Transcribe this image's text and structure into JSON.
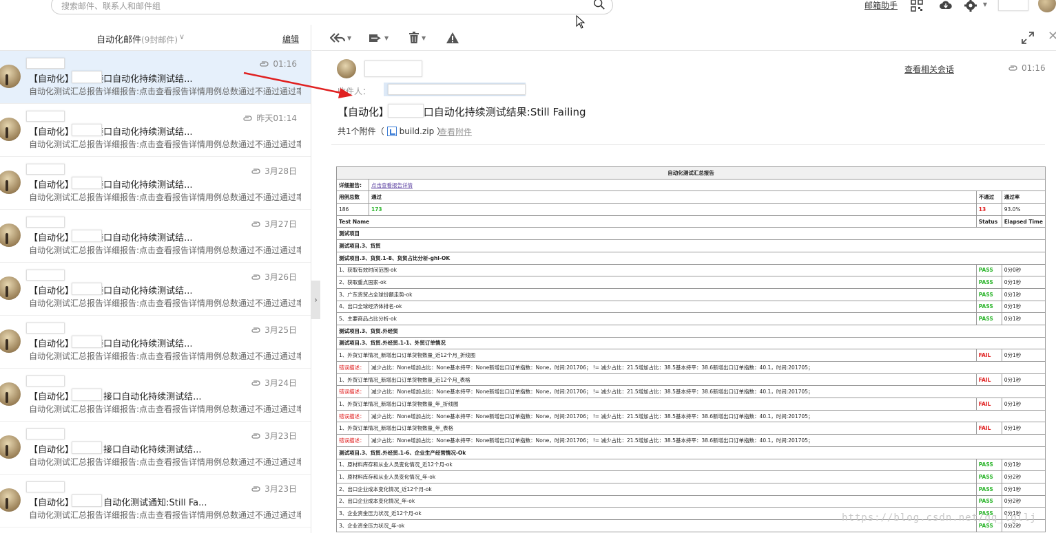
{
  "search": {
    "placeholder": "搜索邮件、联系人和邮件组"
  },
  "toplinks": {
    "helper": "邮箱助手"
  },
  "folder": {
    "title": "自动化邮件",
    "count": "(9封邮件)",
    "edit": "编辑"
  },
  "mails": [
    {
      "time": "01:16",
      "subject": "【自动化】         项目接口自动化持续测试结...",
      "preview": "自动化测试汇总报告详细报告:点击查看报告详情用例总数通过不通过通过率..."
    },
    {
      "time": "昨天01:14",
      "subject": "【自动化】         项目接口自动化持续测试结...",
      "preview": "自动化测试汇总报告详细报告:点击查看报告详情用例总数通过不通过通过率..."
    },
    {
      "time": "3月28日",
      "subject": "【自动化】         项目接口自动化持续测试结...",
      "preview": "自动化测试汇总报告详细报告:点击查看报告详情用例总数通过不通过通过率..."
    },
    {
      "time": "3月27日",
      "subject": "【自动化】         项目接口自动化持续测试结...",
      "preview": "自动化测试汇总报告详细报告:点击查看报告详情用例总数通过不通过通过率..."
    },
    {
      "time": "3月26日",
      "subject": "【自动化】         项目接口自动化持续测试结...",
      "preview": "自动化测试汇总报告详细报告:点击查看报告详情用例总数通过不通过通过率..."
    },
    {
      "time": "3月25日",
      "subject": "【自动化】         项目接口自动化持续测试结...",
      "preview": "自动化测试汇总报告详细报告:点击查看报告详情用例总数通过不通过通过率..."
    },
    {
      "time": "3月24日",
      "subject": "【自动化】        厅项目接口自动化持续测试结...",
      "preview": "自动化测试汇总报告详细报告:点击查看报告详情用例总数通过不通过通过率..."
    },
    {
      "time": "3月23日",
      "subject": "【自动化】        厅项目接口自动化持续测试结...",
      "preview": "自动化测试汇总报告详细报告:点击查看报告详情用例总数通过不通过通过率..."
    },
    {
      "time": "3月23日",
      "subject": "【自动化】        厅项目自动化测试通知:Still Fa...",
      "preview": "自动化测试汇总报告详细报告:点击查看报告详情用例总数通过不通过通过率..."
    }
  ],
  "reader": {
    "related": "查看相关会话",
    "time": "01:16",
    "to_label": "收件人：",
    "subject": "【自动化】          项目接口自动化持续测试结果:Still Failing",
    "attach_prefix": "共1个附件（",
    "attach_name": "build.zip",
    "attach_suffix": "）",
    "view_attach": "查看附件"
  },
  "report": {
    "title": "自动化测试汇总报告",
    "detail_label": "详细报告:",
    "detail_link": "点击查看报告详情",
    "h_total": "用例总数",
    "h_pass": "通过",
    "h_fail": "不通过",
    "h_rate": "通过率",
    "total": "186",
    "pass": "173",
    "fail": "13",
    "rate": "93.0%",
    "col_name": "Test Name",
    "col_status": "Status",
    "col_time": "Elapsed Time",
    "err_label": "错误描述：",
    "err_text": "减少占比：None增加占比：None基本持平：None新增出口订单指数：None，时间:201706； != 减少占比：21.5增加占比：38.5基本持平：38.6新增出口订单指数：40.1，时间:201705；",
    "rows": [
      {
        "type": "section",
        "name": "测试项目"
      },
      {
        "type": "section",
        "name": "测试项目.3、货贸"
      },
      {
        "type": "section",
        "name": "测试项目.3、货贸.1-8、货贸占比分析-ghl-OK"
      },
      {
        "type": "case",
        "name": "1、获取有效时间范围-ok",
        "status": "PASS",
        "time": "0分0秒"
      },
      {
        "type": "case",
        "name": "2、获取重点国家-ok",
        "status": "PASS",
        "time": "0分1秒"
      },
      {
        "type": "case",
        "name": "3、广东货贸占全球份额走势-ok",
        "status": "PASS",
        "time": "0分1秒"
      },
      {
        "type": "case",
        "name": "4、出口全球经济体排名-ok",
        "status": "PASS",
        "time": "0分1秒"
      },
      {
        "type": "case",
        "name": "5、主要商品占比分析-ok",
        "status": "PASS",
        "time": "0分1秒"
      },
      {
        "type": "section",
        "name": "测试项目.3、货贸.外经贸"
      },
      {
        "type": "section",
        "name": "测试项目.3、货贸.外经贸.1-1、外贸订单情况"
      },
      {
        "type": "case",
        "name": "1、外贸订单情况_新增出口订单货物数量_近12个月_折线图",
        "status": "FAIL",
        "time": "0分1秒"
      },
      {
        "type": "error"
      },
      {
        "type": "case",
        "name": "1、外贸订单情况_新增出口订单货物数量_近12个月_表格",
        "status": "FAIL",
        "time": "0分1秒"
      },
      {
        "type": "error"
      },
      {
        "type": "case",
        "name": "1、外贸订单情况_新增出口订单货物数量_年_折线图",
        "status": "FAIL",
        "time": "0分1秒"
      },
      {
        "type": "error"
      },
      {
        "type": "case",
        "name": "1、外贸订单情况_新增出口订单货物数量_年_表格",
        "status": "FAIL",
        "time": "0分1秒"
      },
      {
        "type": "error"
      },
      {
        "type": "section",
        "name": "测试项目.3、货贸.外经贸.1-6、企业生产经营情况-Ok"
      },
      {
        "type": "case",
        "name": "1、原材料库存和从业人员变化情况_近12个月-ok",
        "status": "PASS",
        "time": "0分1秒"
      },
      {
        "type": "case",
        "name": "1、原材料库存和从业人员变化情况_年-ok",
        "status": "PASS",
        "time": "0分2秒"
      },
      {
        "type": "case",
        "name": "2、出口企业成本变化情况_近12个月-ok",
        "status": "PASS",
        "time": "0分1秒"
      },
      {
        "type": "case",
        "name": "2、出口企业成本变化情况_年-ok",
        "status": "PASS",
        "time": "0分2秒"
      },
      {
        "type": "case",
        "name": "3、企业资金压力状况_近12个月-ok",
        "status": "PASS",
        "time": "0分1秒"
      },
      {
        "type": "case",
        "name": "3、企业资金压力状况_年-ok",
        "status": "PASS",
        "time": "0分2秒"
      }
    ]
  },
  "watermark": "https://blog.csdn.net/qq_lgllj",
  "colors": {
    "selected_row": "#e6f0fb",
    "pass": "#2db52d",
    "fail": "#e02020",
    "arrow": "#e02020"
  }
}
